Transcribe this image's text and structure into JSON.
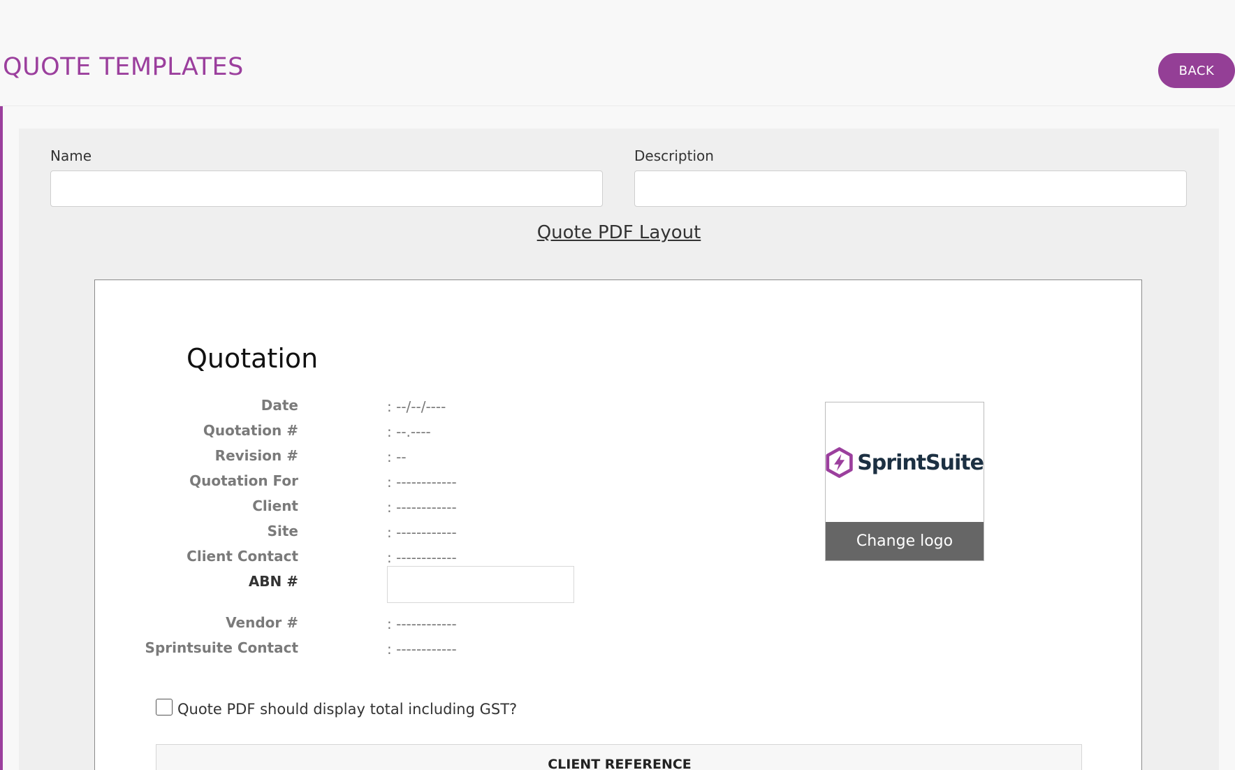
{
  "header": {
    "title": "QUOTE TEMPLATES",
    "back_label": "BACK"
  },
  "form": {
    "name_label": "Name",
    "name_value": "",
    "description_label": "Description",
    "description_value": ""
  },
  "layout_link": "Quote PDF Layout",
  "pdf": {
    "heading": "Quotation",
    "rows": [
      {
        "label": "Date",
        "value": ": --/--/----"
      },
      {
        "label": "Quotation #",
        "value": ": --.----"
      },
      {
        "label": "Revision #",
        "value": ": --"
      },
      {
        "label": "Quotation For",
        "value": ": ------------"
      },
      {
        "label": "Client",
        "value": ": ------------"
      },
      {
        "label": "Site",
        "value": ": ------------"
      },
      {
        "label": "Client Contact",
        "value": ": ------------"
      },
      {
        "label": "ABN #",
        "value": ""
      },
      {
        "label": "Vendor #",
        "value": ": ------------"
      },
      {
        "label": "Sprintsuite Contact",
        "value": ": ------------"
      }
    ],
    "logo_text": "SprintSuite",
    "change_logo": "Change logo",
    "gst_label": "Quote PDF should display total including GST?",
    "gst_checked": false,
    "client_reference_title": "CLIENT REFERENCE"
  },
  "colors": {
    "accent": "#9b3f9d",
    "logo_text": "#1c3042"
  }
}
